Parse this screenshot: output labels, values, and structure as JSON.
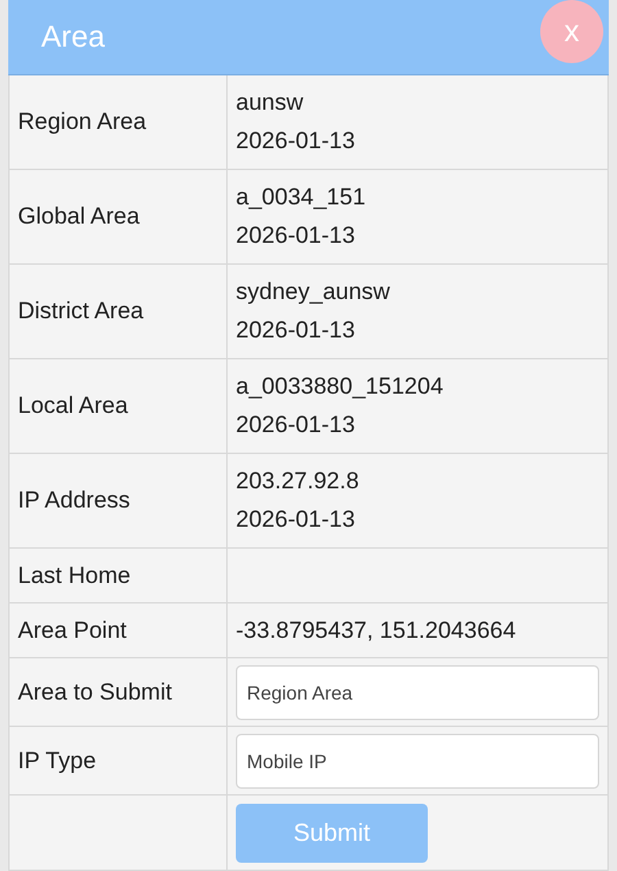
{
  "dialog": {
    "title": "Area",
    "close_label": "x"
  },
  "rows": [
    {
      "kind": "text",
      "label": "Region Area",
      "lines": [
        "aunsw",
        "2026-01-13"
      ]
    },
    {
      "kind": "text",
      "label": "Global Area",
      "lines": [
        "a_0034_151",
        "2026-01-13"
      ]
    },
    {
      "kind": "text",
      "label": "District Area",
      "lines": [
        "sydney_aunsw",
        "2026-01-13"
      ]
    },
    {
      "kind": "text",
      "label": "Local Area",
      "lines": [
        "a_0033880_151204",
        "2026-01-13"
      ]
    },
    {
      "kind": "text",
      "label": "IP Address",
      "lines": [
        "203.27.92.8",
        "2026-01-13"
      ]
    },
    {
      "kind": "text",
      "label": "Last Home",
      "lines": []
    },
    {
      "kind": "text",
      "label": "Area Point",
      "lines": [
        "-33.8795437, 151.2043664"
      ]
    },
    {
      "kind": "input",
      "label": "Area to Submit",
      "value": "Region Area"
    },
    {
      "kind": "input",
      "label": "IP Type",
      "value": "Mobile IP"
    }
  ],
  "submit": {
    "label": "Submit"
  }
}
